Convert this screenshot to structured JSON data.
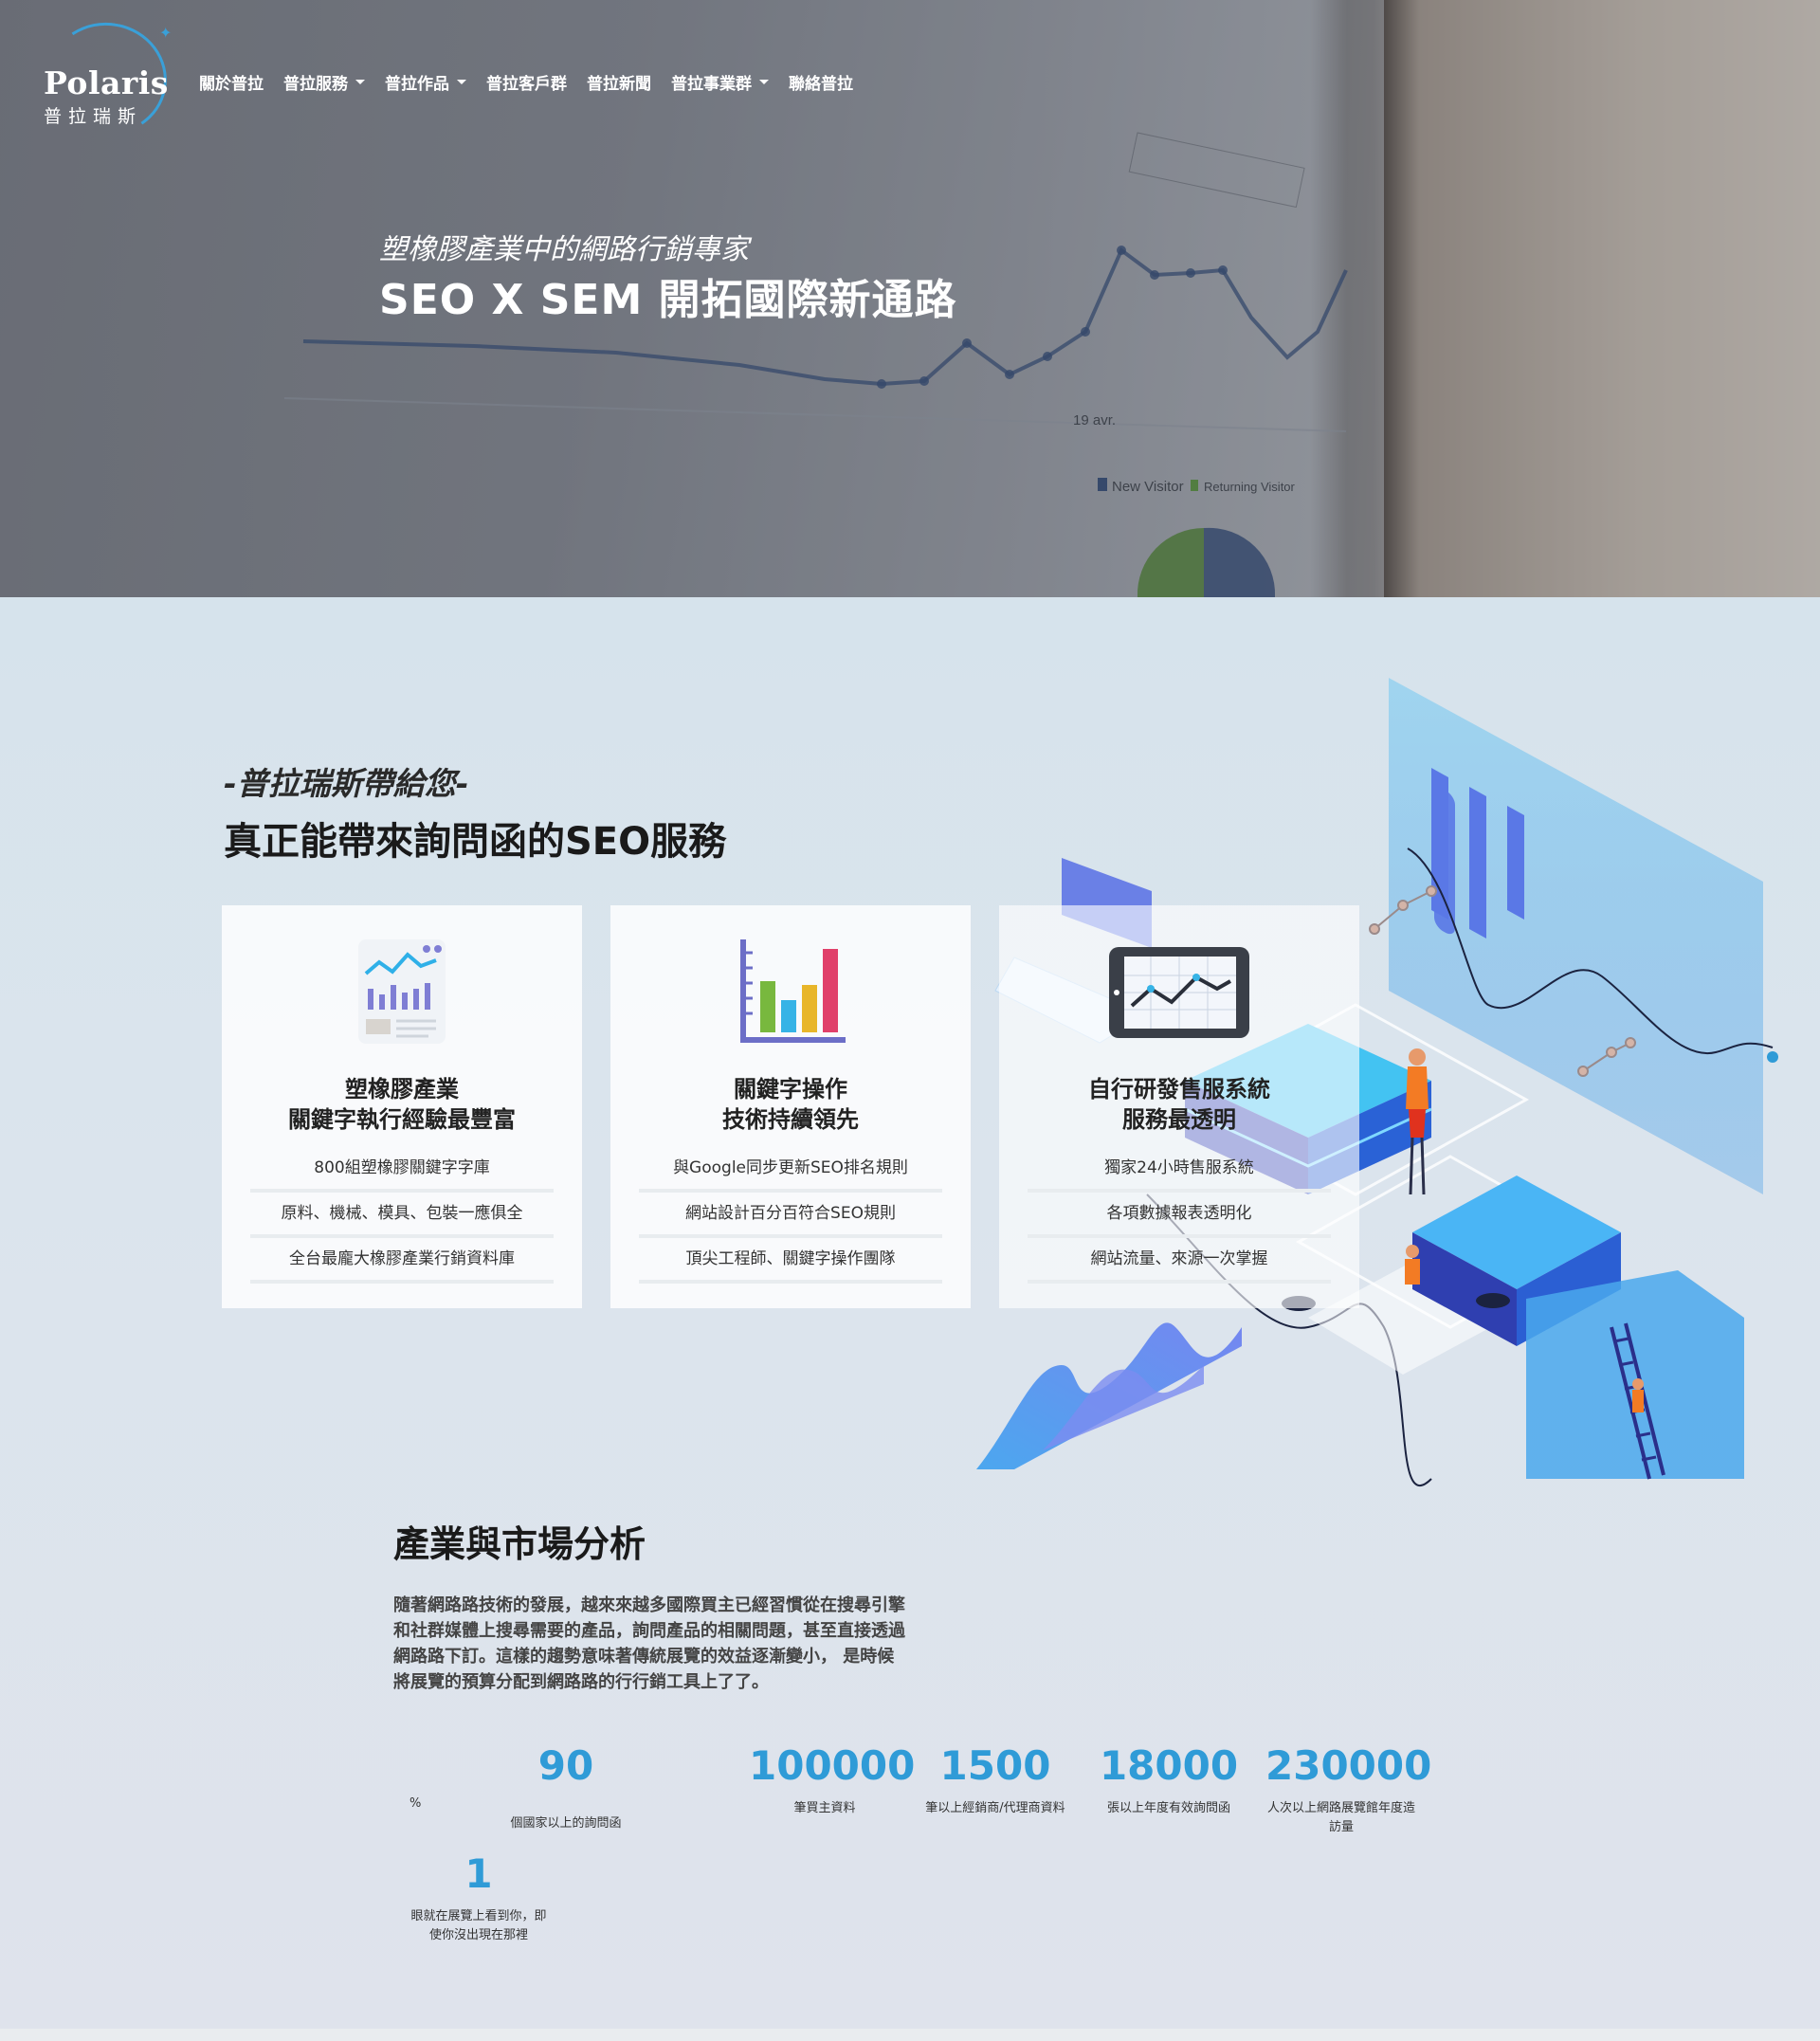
{
  "brand": {
    "name": "Polaris",
    "name_zh": "普拉瑞斯"
  },
  "nav": [
    {
      "label": "關於普拉",
      "dropdown": false
    },
    {
      "label": "普拉服務",
      "dropdown": true
    },
    {
      "label": "普拉作品",
      "dropdown": true
    },
    {
      "label": "普拉客戶群",
      "dropdown": false
    },
    {
      "label": "普拉新聞",
      "dropdown": false
    },
    {
      "label": "普拉事業群",
      "dropdown": true
    },
    {
      "label": "聯絡普拉",
      "dropdown": false
    }
  ],
  "hero": {
    "subtitle": "塑橡膠產業中的網路行銷專家",
    "title": "SEO X SEM 開拓國際新通路",
    "bg_chart_labels": [
      "19 avr.",
      "New Visitor",
      "Returning Visitor"
    ]
  },
  "services": {
    "subtitle": "-普拉瑞斯帶給您-",
    "title": "真正能帶來詢問函的SEO服務",
    "cards": [
      {
        "icon": "analytics-report-icon",
        "heading": [
          "塑橡膠產業",
          "關鍵字執行經驗最豐富"
        ],
        "rows": [
          "800組塑橡膠關鍵字字庫",
          "原料、機械、模具、包裝一應俱全",
          "全台最龐大橡膠產業行銷資料庫"
        ]
      },
      {
        "icon": "bar-chart-icon",
        "heading": [
          "關鍵字操作",
          "技術持續領先"
        ],
        "rows": [
          "與Google同步更新SEO排名規則",
          "網站設計百分百符合SEO規則",
          "頂尖工程師、關鍵字操作團隊"
        ]
      },
      {
        "icon": "tablet-line-chart-icon",
        "heading": [
          "自行研發售服系統",
          "服務最透明"
        ],
        "rows": [
          "獨家24小時售服系統",
          "各項數據報表透明化",
          "網站流量、來源一次掌握"
        ]
      }
    ]
  },
  "market": {
    "title": "產業與市場分析",
    "body": "隨著網路路技術的發展，越來來越多國際買主已經習慣從在搜尋引擎和社群媒體上搜尋需要的產品，詢問產品的相關問題，甚至直接透過網路路下訂。這樣的趨勢意味著傳統展覽的效益逐漸變小， 是時候將展覽的預算分配到網路路的行行銷工具上了了。",
    "percent_sign": "%",
    "stats": [
      {
        "value": "90",
        "label": "個國家以上的詢問函"
      },
      {
        "value": "100000",
        "label": "筆買主資料"
      },
      {
        "value": "1500",
        "label": "筆以上經銷商/代理商資料"
      },
      {
        "value": "18000",
        "label": "張以上年度有效詢問函"
      },
      {
        "value": "230000",
        "label": "人次以上網路展覽館年度造訪量"
      },
      {
        "value": "1",
        "label": "眼就在展覽上看到你，即使你沒出現在那裡"
      }
    ]
  },
  "colors": {
    "accent": "#2f9bd7",
    "ring": "#3aa0d8"
  }
}
